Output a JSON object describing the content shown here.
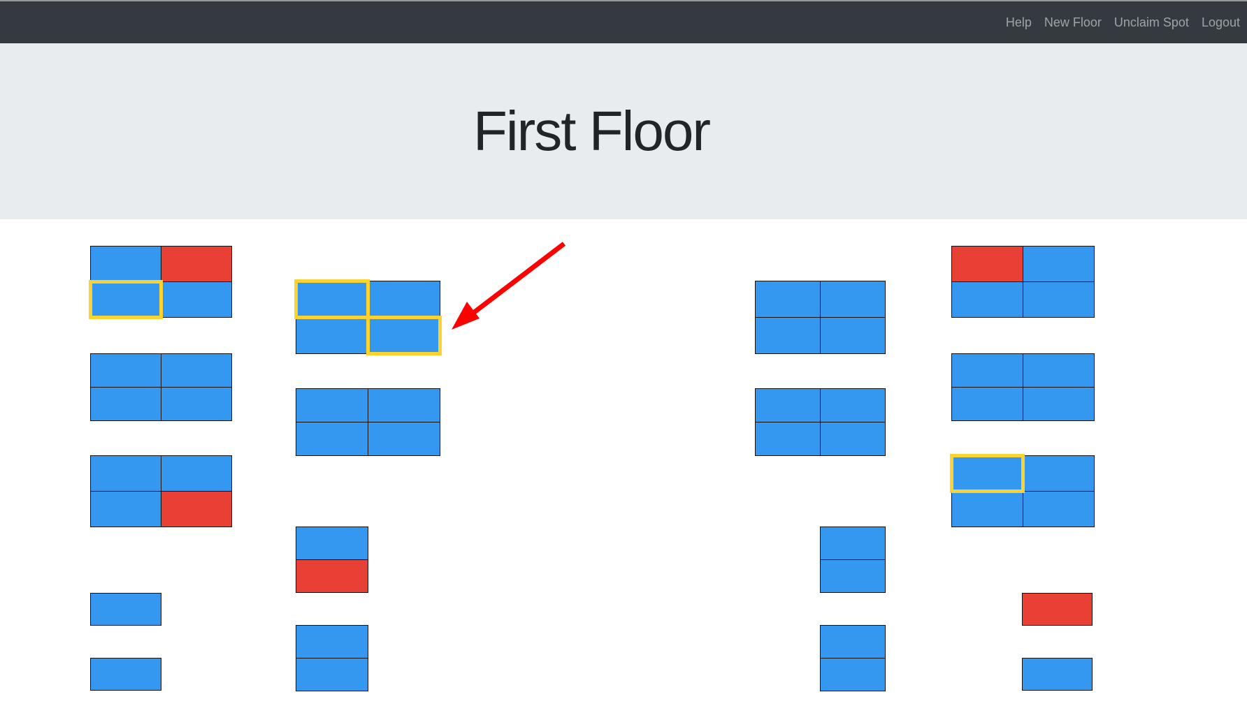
{
  "nav": {
    "links": [
      "Help",
      "New Floor",
      "Unclaim Spot",
      "Logout"
    ]
  },
  "header": {
    "title": "First Floor"
  },
  "floor": {
    "groups": [
      [
        "free",
        "taken",
        "free-selected",
        "free"
      ],
      [
        "free",
        "free",
        "free",
        "free"
      ],
      [
        "free",
        "free",
        "free",
        "taken"
      ],
      [
        "free"
      ],
      [
        "free"
      ],
      [
        "free-selected",
        "free",
        "free",
        "free-selected"
      ],
      [
        "free",
        "free",
        "free",
        "free"
      ],
      [
        "free",
        "taken"
      ],
      [
        "free",
        "free"
      ],
      [
        "free",
        "free",
        "free",
        "free"
      ],
      [
        "free",
        "free",
        "free",
        "free"
      ],
      [
        "free",
        "free"
      ],
      [
        "free",
        "free"
      ],
      [
        "taken",
        "free",
        "free",
        "free"
      ],
      [
        "free",
        "free",
        "free",
        "free"
      ],
      [
        "free-selected",
        "free",
        "free",
        "free"
      ],
      [
        "taken"
      ],
      [
        "free"
      ]
    ]
  },
  "colors": {
    "free": "#3498f0",
    "taken": "#e94035",
    "selected": "#fbd331",
    "annotation_arrow": "#ff0000"
  }
}
